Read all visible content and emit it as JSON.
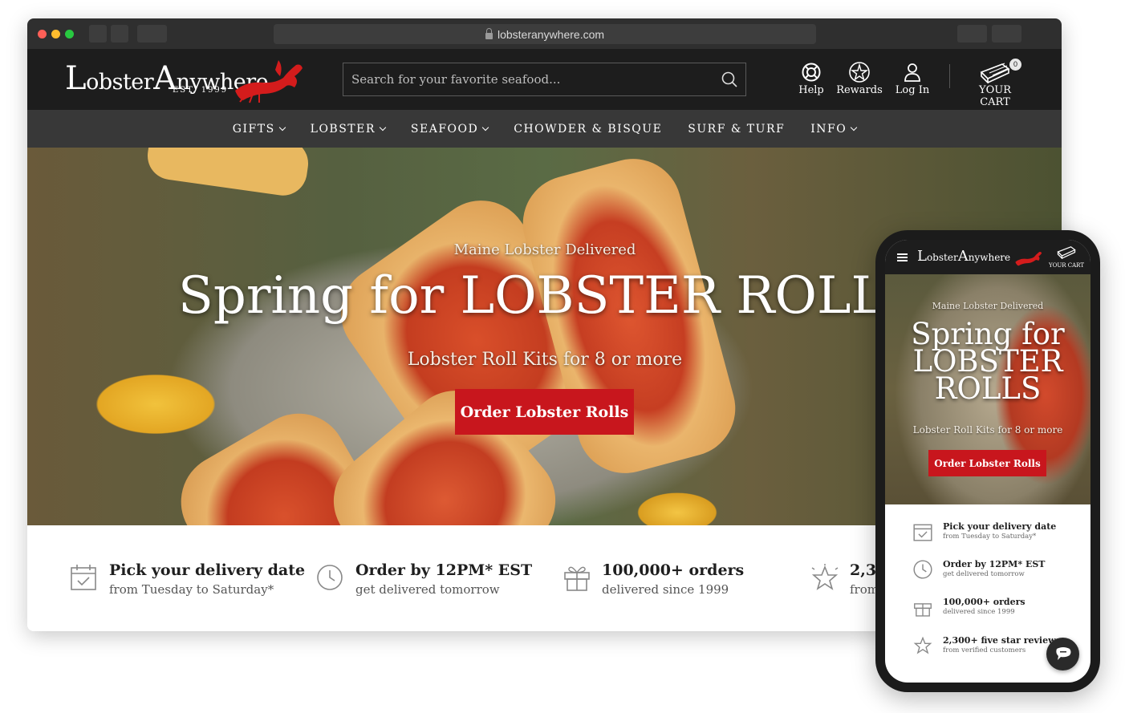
{
  "browser": {
    "url": "lobsteranywhere.com"
  },
  "brand": {
    "logo_part1": "L",
    "logo_part2": "obster",
    "logo_part3": "A",
    "logo_part4": "nywhere",
    "est": "EST. 1999",
    "accent": "#c8161d"
  },
  "search": {
    "placeholder": "Search for your favorite seafood..."
  },
  "utility": {
    "help": "Help",
    "rewards": "Rewards",
    "login": "Log In",
    "cart": "YOUR CART",
    "cart_count": "0"
  },
  "nav": {
    "items": [
      {
        "label": "GIFTS",
        "dropdown": true
      },
      {
        "label": "LOBSTER",
        "dropdown": true
      },
      {
        "label": "SEAFOOD",
        "dropdown": true
      },
      {
        "label": "CHOWDER & BISQUE",
        "dropdown": false
      },
      {
        "label": "SURF & TURF",
        "dropdown": false
      },
      {
        "label": "INFO",
        "dropdown": true
      }
    ]
  },
  "hero": {
    "kicker": "Maine Lobster Delivered",
    "title": "Spring for LOBSTER ROLLS",
    "subtitle": "Lobster Roll Kits for 8 or more",
    "cta": "Order Lobster Rolls"
  },
  "features": [
    {
      "icon": "calendar-check-icon",
      "title": "Pick your delivery date",
      "sub": "from Tuesday to Saturday*"
    },
    {
      "icon": "clock-icon",
      "title": "Order by 12PM* EST",
      "sub": "get delivered tomorrow"
    },
    {
      "icon": "gift-icon",
      "title": "100,000+ orders",
      "sub": "delivered since 1999"
    },
    {
      "icon": "star-icon",
      "title": "2,300+ five star reviews",
      "sub": "from verified customers"
    }
  ],
  "mobile": {
    "cart_label": "YOUR CART",
    "cart_count": "0",
    "title_line1": "Spring for",
    "title_line2": "LOBSTER",
    "title_line3": "ROLLS"
  }
}
